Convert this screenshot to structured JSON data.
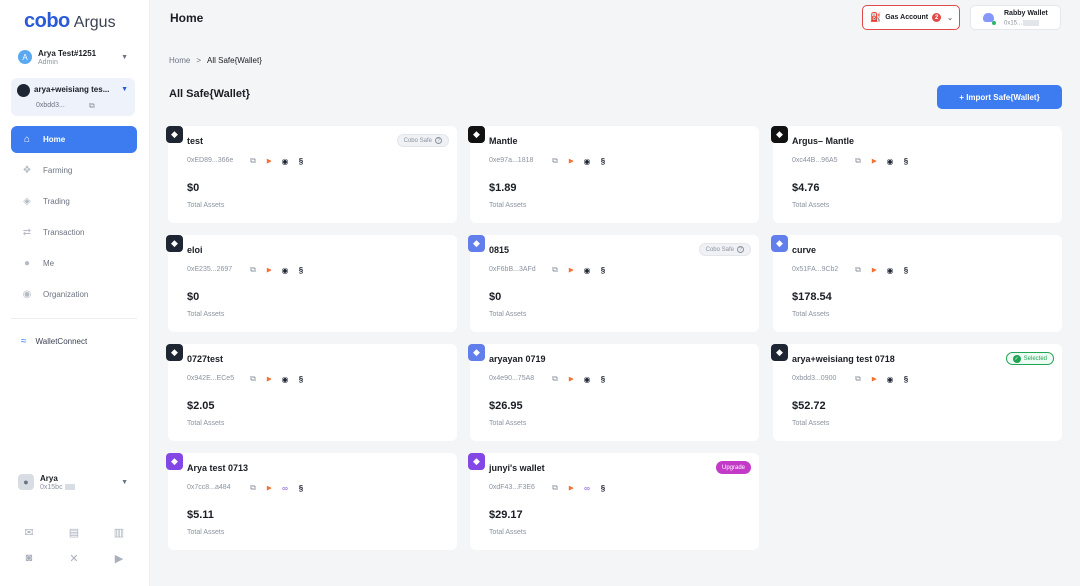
{
  "brand": {
    "logo_left": "cobo",
    "logo_right": "Argus"
  },
  "org": {
    "name": "Arya Test#1251",
    "role": "Admin",
    "initial": "A"
  },
  "current_wallet": {
    "name": "arya+weisiang tes...",
    "address": "0xbdd3..."
  },
  "nav": [
    {
      "label": "Home",
      "icon": "home-icon",
      "glyph": "⌂",
      "active": true
    },
    {
      "label": "Farming",
      "icon": "farming-icon",
      "glyph": "❖",
      "active": false
    },
    {
      "label": "Trading",
      "icon": "trading-icon",
      "glyph": "◈",
      "active": false
    },
    {
      "label": "Transaction",
      "icon": "transaction-icon",
      "glyph": "⇄",
      "active": false
    },
    {
      "label": "Me",
      "icon": "user-icon",
      "glyph": "●",
      "active": false
    },
    {
      "label": "Organization",
      "icon": "organization-icon",
      "glyph": "◉",
      "active": false
    }
  ],
  "walletconnect": {
    "label": "WalletConnect",
    "glyph": "≈"
  },
  "user": {
    "name": "Arya",
    "address": "0x15bc"
  },
  "social_icons": [
    {
      "name": "mail-icon",
      "glyph": "✉"
    },
    {
      "name": "book-icon",
      "glyph": "▤"
    },
    {
      "name": "map-icon",
      "glyph": "▥"
    },
    {
      "name": "discord-icon",
      "glyph": "◙"
    },
    {
      "name": "x-icon",
      "glyph": "✕"
    },
    {
      "name": "youtube-icon",
      "glyph": "▶"
    }
  ],
  "header": {
    "title": "Home",
    "gas": {
      "label": "Gas Account",
      "badge": "2"
    },
    "rabby": {
      "name": "Rabby Wallet",
      "address": "0x15..."
    }
  },
  "breadcrumb": {
    "home": "Home",
    "separator": ">",
    "current": "All Safe{Wallet}"
  },
  "section_title": "All Safe{Wallet}",
  "import_button": "+ Import Safe{Wallet}",
  "colors": {
    "primary": "#3d7bf0",
    "danger": "#e14a4a",
    "success": "#22a455",
    "upgrade": "#c33ac9"
  },
  "cards": [
    {
      "name": "test",
      "address": "0xED89...366e",
      "amount": "$0",
      "label": "Total Assets",
      "icon_color": "#1e2533",
      "tag": "Cobo Safe",
      "tag_type": "cobo",
      "col": 0,
      "row": 0,
      "chains": [
        "i-scan",
        "i-chain",
        "i-more"
      ]
    },
    {
      "name": "Mantle",
      "address": "0xe97a...1818",
      "amount": "$1.89",
      "label": "Total Assets",
      "icon_color": "#111111",
      "tag": "",
      "tag_type": "",
      "col": 1,
      "row": 0,
      "chains": [
        "i-scan",
        "i-chain",
        "i-more"
      ]
    },
    {
      "name": "Argus– Mantle",
      "address": "0xc44B...96A5",
      "amount": "$4.76",
      "label": "Total Assets",
      "icon_color": "#111111",
      "tag": "",
      "tag_type": "",
      "col": 2,
      "row": 0,
      "chains": [
        "i-scan",
        "i-chain",
        "i-more"
      ]
    },
    {
      "name": "eloi",
      "address": "0xE235...2697",
      "amount": "$0",
      "label": "Total Assets",
      "icon_color": "#1e2533",
      "tag": "",
      "tag_type": "",
      "col": 0,
      "row": 1,
      "chains": [
        "i-scan",
        "i-chain",
        "i-more"
      ]
    },
    {
      "name": "0815",
      "address": "0xF6bB...3AFd",
      "amount": "$0",
      "label": "Total Assets",
      "icon_color": "#627eea",
      "tag": "Cobo Safe",
      "tag_type": "cobo",
      "col": 1,
      "row": 1,
      "chains": [
        "i-scan",
        "i-chain",
        "i-more"
      ]
    },
    {
      "name": "curve",
      "address": "0x51FA...9Cb2",
      "amount": "$178.54",
      "label": "Total Assets",
      "icon_color": "#627eea",
      "tag": "",
      "tag_type": "",
      "col": 2,
      "row": 1,
      "chains": [
        "i-scan",
        "i-chain",
        "i-more"
      ]
    },
    {
      "name": "0727test",
      "address": "0x942E...ECe5",
      "amount": "$2.05",
      "label": "Total Assets",
      "icon_color": "#1e2533",
      "tag": "",
      "tag_type": "",
      "col": 0,
      "row": 2,
      "chains": [
        "i-scan",
        "i-chain",
        "i-more"
      ]
    },
    {
      "name": "aryayan 0719",
      "address": "0x4e90...75A8",
      "amount": "$26.95",
      "label": "Total Assets",
      "icon_color": "#627eea",
      "tag": "",
      "tag_type": "",
      "col": 1,
      "row": 2,
      "chains": [
        "i-scan",
        "i-chain",
        "i-more"
      ]
    },
    {
      "name": "arya+weisiang test 0718",
      "address": "0xbdd3...0900",
      "amount": "$52.72",
      "label": "Total Assets",
      "icon_color": "#1e2533",
      "tag": "Selected",
      "tag_type": "selected",
      "col": 2,
      "row": 2,
      "chains": [
        "i-scan",
        "i-chain",
        "i-more"
      ]
    },
    {
      "name": "Arya test 0713",
      "address": "0x7cc8...a484",
      "amount": "$5.11",
      "label": "Total Assets",
      "icon_color": "#8247e5",
      "tag": "",
      "tag_type": "",
      "col": 0,
      "row": 3,
      "chains": [
        "i-scan",
        "i-hook",
        "i-more"
      ]
    },
    {
      "name": "junyi's wallet",
      "address": "0xdF43...F3E6",
      "amount": "$29.17",
      "label": "Total Assets",
      "icon_color": "#8247e5",
      "tag": "Upgrade",
      "tag_type": "upgrade",
      "col": 1,
      "row": 3,
      "chains": [
        "i-scan",
        "i-hook",
        "i-more"
      ]
    }
  ]
}
